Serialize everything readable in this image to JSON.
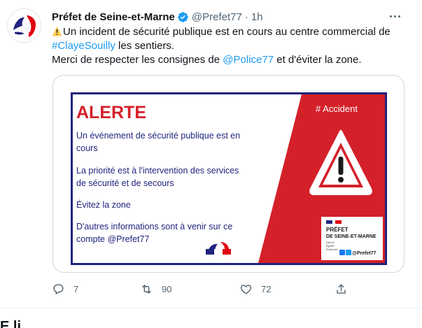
{
  "tweet": {
    "author_name": "Préfet de Seine-et-Marne",
    "handle": "@Prefet77",
    "separator": "·",
    "time": "1h",
    "body": {
      "line1": "Un incident de sécurité publique est en cours au centre commercial de",
      "hashtag": "#ClayeSouilly",
      "line2_rest": " les sentiers.",
      "line3_prefix": "Merci de respecter les consignes de ",
      "mention": "@Police77",
      "line3_suffix": " et d'éviter la zone."
    },
    "media": {
      "title": "ALERTE",
      "tag": "# Accident",
      "paragraphs": [
        "Un événement de sécurité publique est en",
        "cours",
        "La priorité est à l'intervention des services",
        "de sécurité et de secours",
        "Évitez la zone",
        "D'autres informations sont à venir sur ce",
        "compte @Prefet77"
      ],
      "prefecture_line1": "PRÉFET",
      "prefecture_line2": "DE SEINE-ET-MARNE",
      "motto": [
        "Liberté",
        "Égalité",
        "Fraternité"
      ],
      "social_handle": "@Prefet77"
    },
    "actions": {
      "replies": "7",
      "retweets": "90",
      "likes": "72"
    },
    "icons": [
      "verified-icon",
      "more-icon",
      "warning-icon",
      "reply-icon",
      "retweet-icon",
      "like-icon",
      "share-icon"
    ],
    "colors": {
      "link": "#1d9bf0",
      "alert_red": "#d42029",
      "navy": "#21247d",
      "muted": "#536471"
    }
  },
  "next_tweet": {
    "name_fragment": "E li"
  }
}
